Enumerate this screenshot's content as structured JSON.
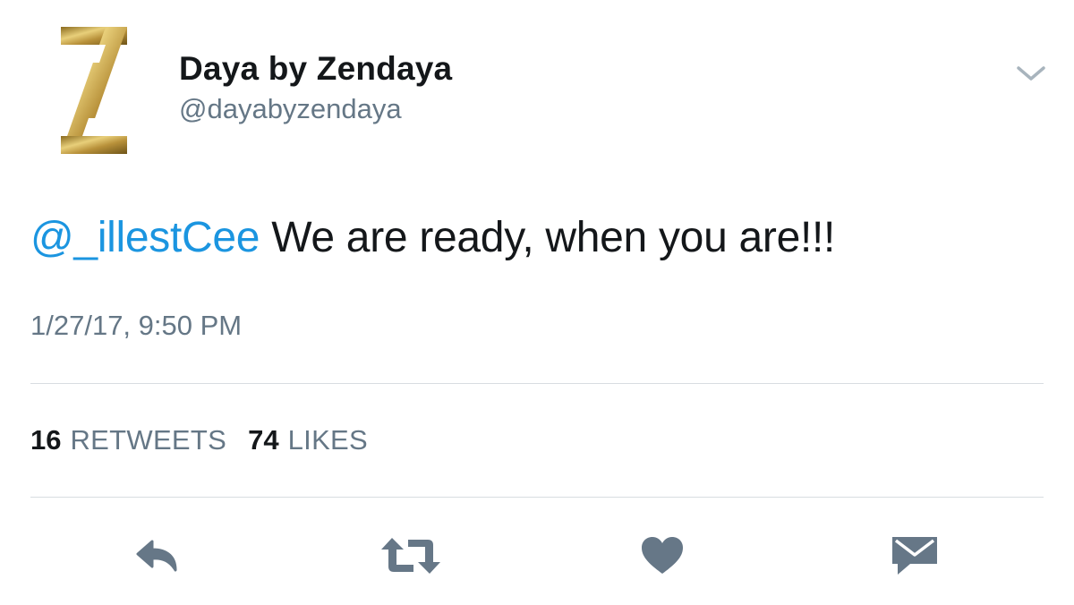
{
  "tweet": {
    "display_name": "Daya by Zendaya",
    "handle": "@dayabyzendaya",
    "avatar_icon": "gold-z-logo",
    "mention": "@_illestCee",
    "body": " We are ready, when you are!!!",
    "timestamp": "1/27/17, 9:50 PM",
    "retweets": {
      "count": "16",
      "label": "RETWEETS"
    },
    "likes": {
      "count": "74",
      "label": "LIKES"
    }
  },
  "actions": {
    "reply_icon": "reply-icon",
    "retweet_icon": "retweet-icon",
    "like_icon": "heart-icon",
    "dm_icon": "envelope-icon",
    "menu_icon": "chevron-down-icon"
  },
  "colors": {
    "text": "#14171a",
    "secondary": "#657786",
    "link": "#1b95e0",
    "divider": "#d8dde1",
    "gold": "#c9a84c"
  }
}
